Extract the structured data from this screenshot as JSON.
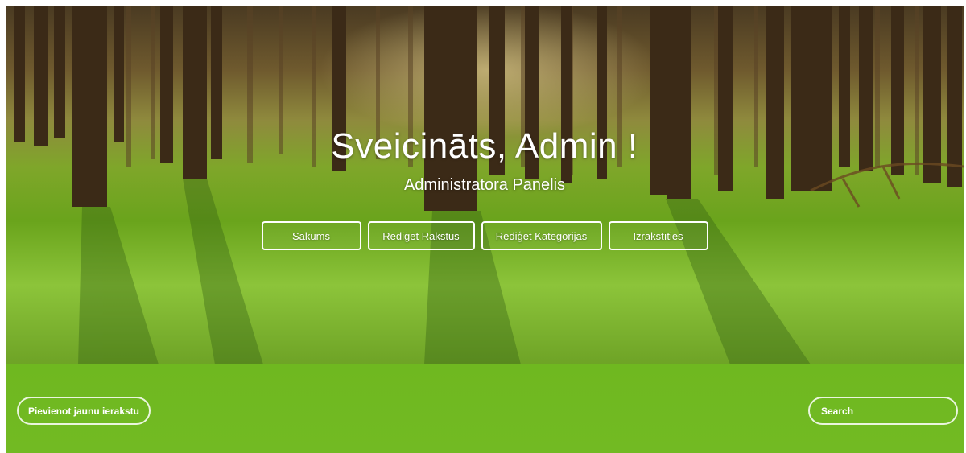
{
  "hero": {
    "title": "Sveicināts, Admin !",
    "subtitle": "Administratora Panelis"
  },
  "nav": {
    "items": [
      {
        "label": "Sākums"
      },
      {
        "label": "Rediģēt Rakstus"
      },
      {
        "label": "Rediģēt Kategorijas"
      },
      {
        "label": "Izrakstīties"
      }
    ]
  },
  "toolbar": {
    "add_label": "Pievienot jaunu ierakstu",
    "search_placeholder": "Search"
  },
  "colors": {
    "accent_green": "#72ba23",
    "button_border": "#ffffff"
  }
}
